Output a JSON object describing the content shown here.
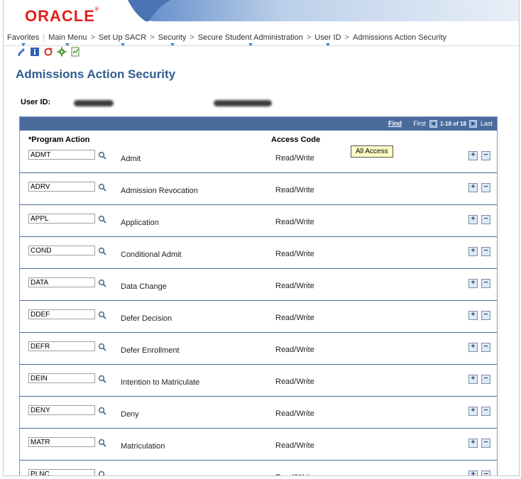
{
  "brand": {
    "logo_text": "ORACLE",
    "brand_color": "#e0201b"
  },
  "breadcrumb": {
    "items": [
      "Favorites",
      "Main Menu",
      "Set Up SACR",
      "Security",
      "Secure Student Administration",
      "User ID",
      "Admissions Action Security"
    ]
  },
  "toolbar": {
    "icons": [
      "pencil-icon",
      "info-icon",
      "refresh-icon",
      "gear-icon",
      "report-icon"
    ]
  },
  "page": {
    "title": "Admissions Action Security",
    "user_id_label": "User ID:"
  },
  "grid": {
    "find_label": "Find",
    "first_label": "First",
    "range": "1-18 of 18",
    "last_label": "Last",
    "col_program_action": "*Program Action",
    "col_access_code": "Access Code",
    "tooltip": "All Access",
    "rows": [
      {
        "code": "ADMT",
        "description": "Admit",
        "access": "Read/Write"
      },
      {
        "code": "ADRV",
        "description": "Admission Revocation",
        "access": "Read/Write"
      },
      {
        "code": "APPL",
        "description": "Application",
        "access": "Read/Write"
      },
      {
        "code": "COND",
        "description": "Conditional Admit",
        "access": "Read/Write"
      },
      {
        "code": "DATA",
        "description": "Data Change",
        "access": "Read/Write"
      },
      {
        "code": "DDEF",
        "description": "Defer Decision",
        "access": "Read/Write"
      },
      {
        "code": "DEFR",
        "description": "Defer Enrollment",
        "access": "Read/Write"
      },
      {
        "code": "DEIN",
        "description": "Intention to Matriculate",
        "access": "Read/Write"
      },
      {
        "code": "DENY",
        "description": "Deny",
        "access": "Read/Write"
      },
      {
        "code": "MATR",
        "description": "Matriculation",
        "access": "Read/Write"
      },
      {
        "code": "PLNC",
        "description": "",
        "access": "Read/Write"
      }
    ]
  }
}
